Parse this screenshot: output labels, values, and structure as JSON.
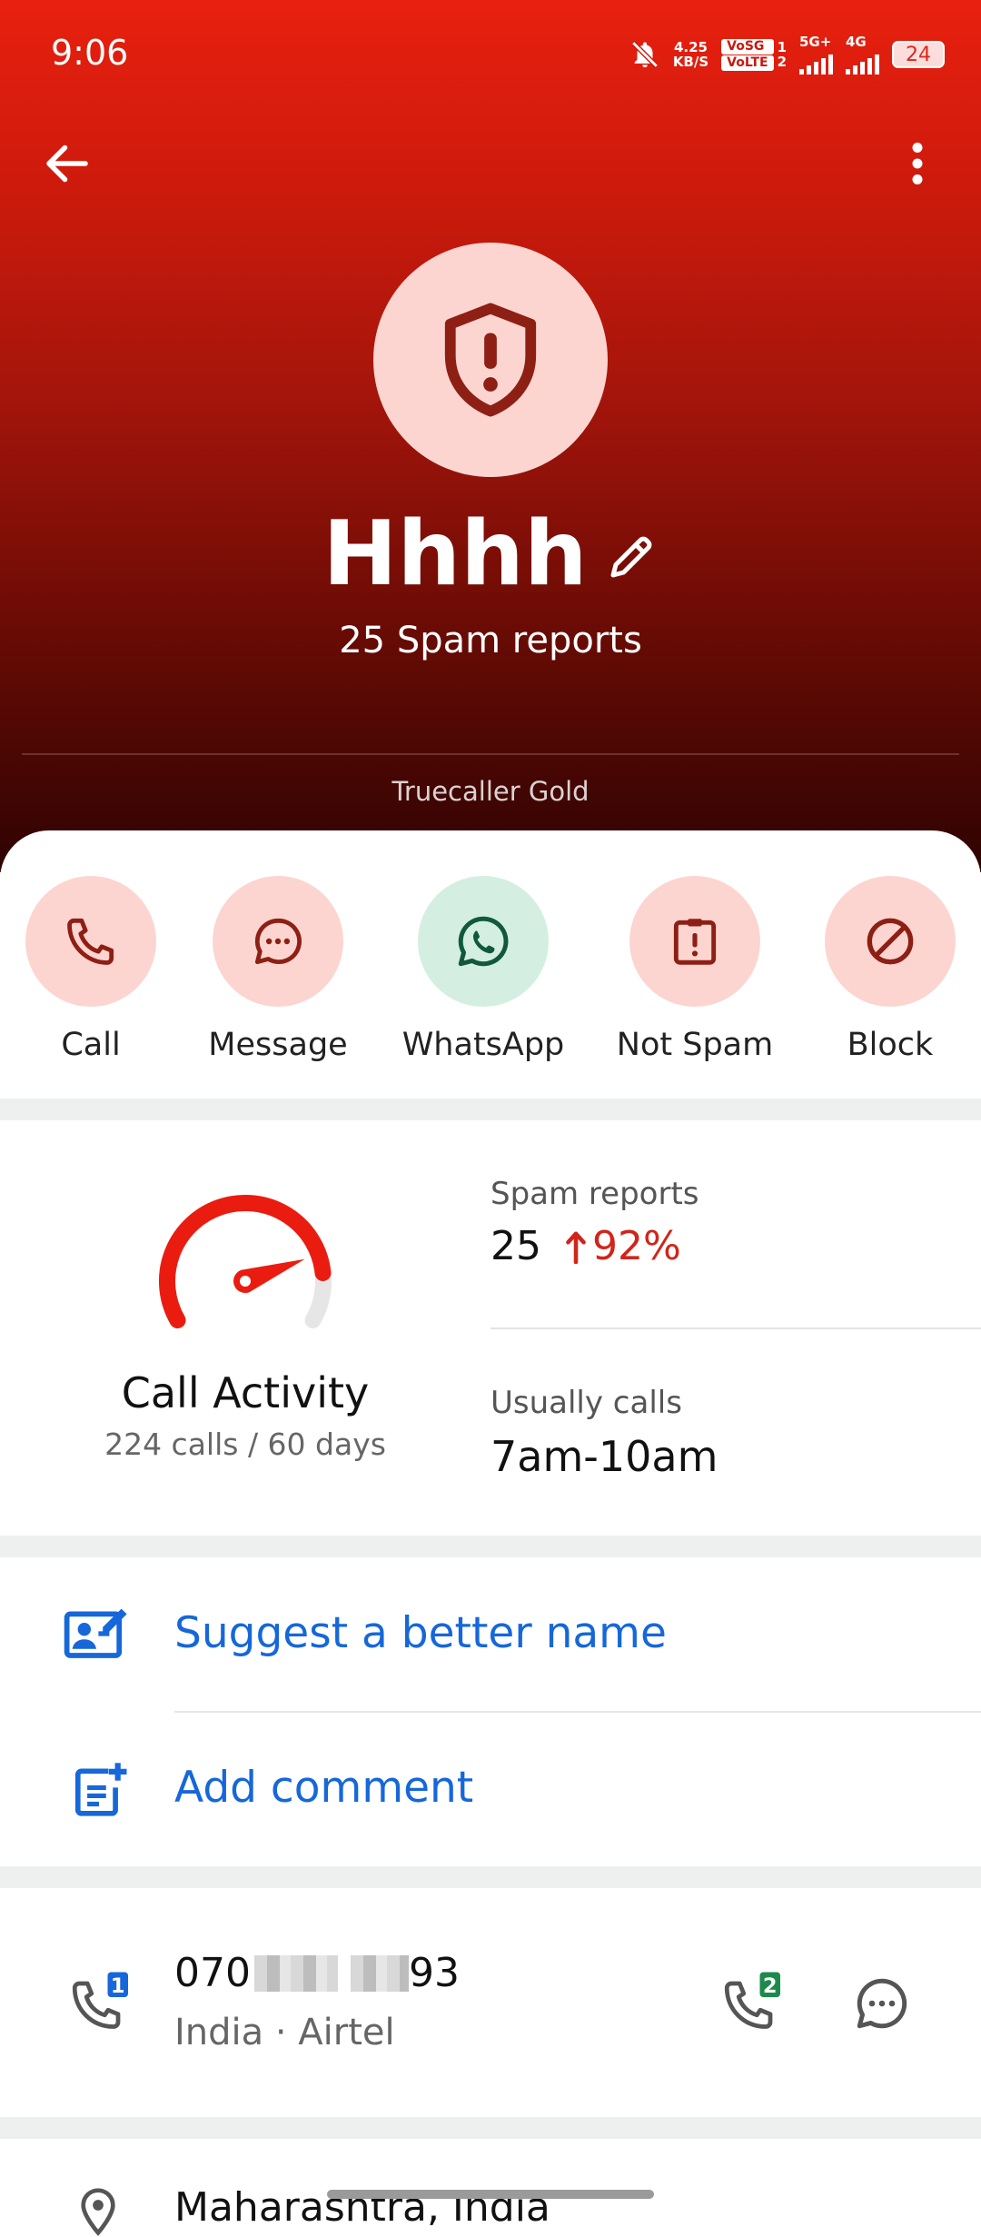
{
  "status_bar": {
    "time": "9:06",
    "speed_value": "4.25",
    "speed_unit": "KB/S",
    "volte_top": "VoSG",
    "volte_bottom": "VoLTE",
    "sim1": "1",
    "sim2": "2",
    "net1": "5G+",
    "net2": "4G",
    "battery": "24"
  },
  "header": {
    "name": "Hhhh",
    "spam_reports": "25 Spam reports",
    "badge": "Truecaller Gold"
  },
  "actions": [
    {
      "label": "Call"
    },
    {
      "label": "Message"
    },
    {
      "label": "WhatsApp"
    },
    {
      "label": "Not Spam"
    },
    {
      "label": "Block"
    }
  ],
  "activity": {
    "title": "Call Activity",
    "subtitle": "224 calls / 60 days",
    "gauge_level": 0.85,
    "spam_label": "Spam reports",
    "spam_value": "25",
    "spam_change": "92%",
    "usual_label": "Usually calls",
    "usual_value": "7am-10am"
  },
  "options": {
    "suggest": "Suggest a better name",
    "comment": "Add comment"
  },
  "number": {
    "prefix": "070",
    "suffix": "93",
    "details": "India · Airtel",
    "sim1_badge": "1",
    "sim2_badge": "2"
  },
  "location": {
    "text": "Maharashtra, India"
  },
  "colors": {
    "accent_blue": "#1667d9",
    "spam_red": "#d1251a",
    "icon_red": "#8e1f14",
    "whatsapp_green": "#11583c"
  }
}
